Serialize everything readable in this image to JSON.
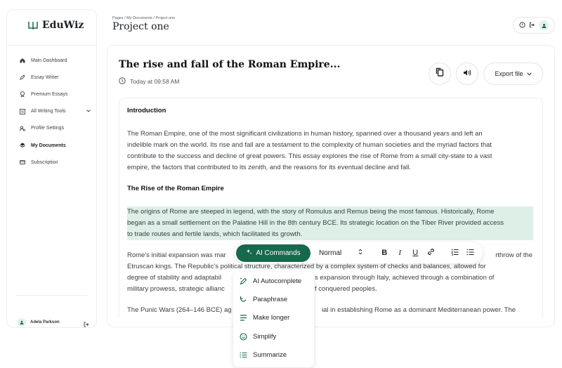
{
  "brand": {
    "name": "EduWiz",
    "accent": "#17694c"
  },
  "sidebar": {
    "items": [
      {
        "label": "Main Dashboard",
        "icon": "home-icon"
      },
      {
        "label": "Essay Writer",
        "icon": "pen-icon"
      },
      {
        "label": "Premium Essays",
        "icon": "badge-icon"
      },
      {
        "label": "All Writing Tools",
        "icon": "tools-icon"
      },
      {
        "label": "Profile Settings",
        "icon": "profile-settings-icon"
      },
      {
        "label": "My Documents",
        "icon": "layers-icon"
      },
      {
        "label": "Subscription",
        "icon": "card-icon"
      }
    ],
    "user": {
      "name": "Adela Parkson"
    }
  },
  "header": {
    "breadcrumb": "Pages / My Documents / Project one",
    "title": "Project one"
  },
  "document": {
    "title": "The rise and fall of the Roman Empire...",
    "time": "Today at 09:58 AM",
    "export_label": "Export file",
    "intro_heading": "Introduction",
    "p1": [
      "The Roman Empire, one of the most significant civilizations in human history, spanned over a thousand years and left an",
      "indelible mark on the world. Its rise and fall are a testament to the complexity of human societies and the myriad factors that",
      "contribute to the success and decline of great powers. This essay explores the rise of Rome from a small city-state to a vast",
      "empire, the factors that contributed to its zenith, and the reasons for its eventual decline and fall."
    ],
    "rise_heading": "The Rise of the Roman Empire",
    "p2": [
      "The origins of Rome are steeped in legend, with the story of Romulus and Remus being the most famous. Historically, Rome",
      "began as a small settlement on the Palatine Hill in the 8th century BCE. Its strategic location on the Tiber River provided access",
      "to trade routes and fertile lands, which facilitated its growth."
    ],
    "p3_left": [
      "Rome's initial expansion was mar",
      "Etruscan kings. The Republic's political structure, characterized by a complex system of checks and balances, allowed for",
      "degree of stability and adaptabil",
      "military prowess, strategic allianc"
    ],
    "p3_right": [
      "rthrow of the",
      "",
      "s expansion through Italy, achieved through a combination of",
      "f conquered peoples."
    ],
    "p4_left": "The Punic Wars (264–146 BCE) ag",
    "p4_right": "ial in establishing Rome as a dominant Mediterranean power. The"
  },
  "toolbar": {
    "ai_label": "AI Commands",
    "style": "Normal",
    "bold": "B",
    "italic": "I",
    "underline": "U"
  },
  "ai_menu": [
    {
      "label": "AI Autocomplete",
      "icon": "magic-pen-icon"
    },
    {
      "label": "Paraphrase",
      "icon": "refresh-icon"
    },
    {
      "label": "Make longer",
      "icon": "lines-icon"
    },
    {
      "label": "Simplify",
      "icon": "smile-icon"
    },
    {
      "label": "Summarize",
      "icon": "list-icon"
    }
  ]
}
